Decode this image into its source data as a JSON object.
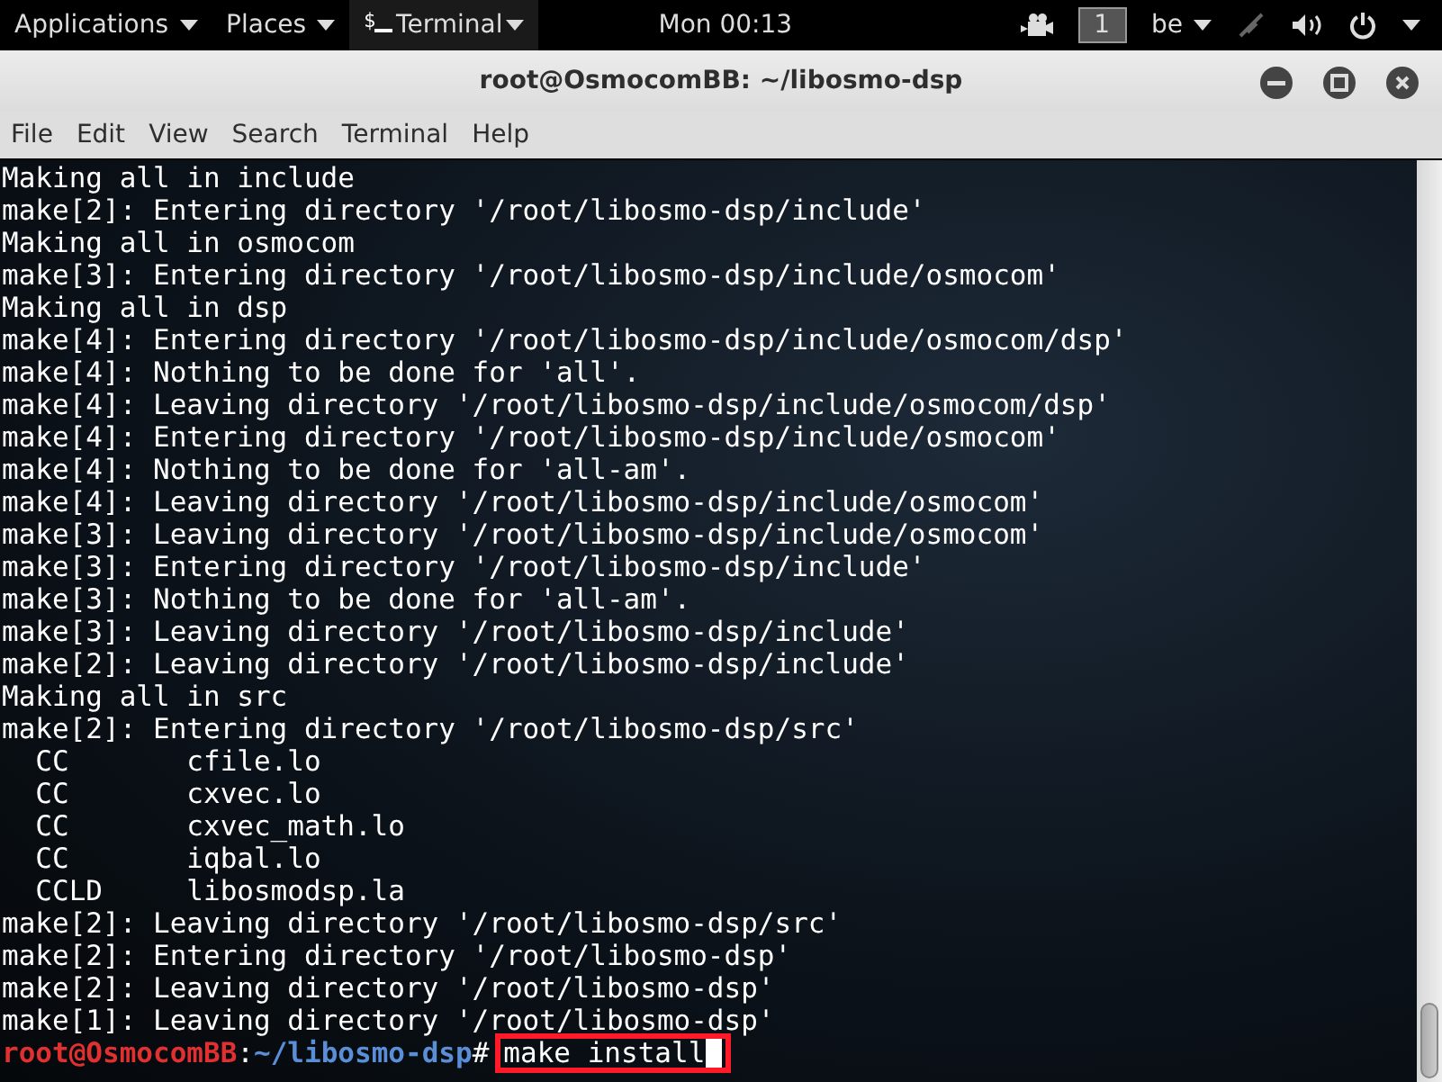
{
  "top_bar": {
    "applications": "Applications",
    "places": "Places",
    "app_icon_glyph": "$",
    "app_menu": "Terminal",
    "clock": "Mon 00:13",
    "workspace": "1",
    "keyboard_layout": "be"
  },
  "window": {
    "title": "root@OsmocomBB: ~/libosmo-dsp"
  },
  "menu": [
    "File",
    "Edit",
    "View",
    "Search",
    "Terminal",
    "Help"
  ],
  "terminal": {
    "lines": [
      "Making all in include",
      "make[2]: Entering directory '/root/libosmo-dsp/include'",
      "Making all in osmocom",
      "make[3]: Entering directory '/root/libosmo-dsp/include/osmocom'",
      "Making all in dsp",
      "make[4]: Entering directory '/root/libosmo-dsp/include/osmocom/dsp'",
      "make[4]: Nothing to be done for 'all'.",
      "make[4]: Leaving directory '/root/libosmo-dsp/include/osmocom/dsp'",
      "make[4]: Entering directory '/root/libosmo-dsp/include/osmocom'",
      "make[4]: Nothing to be done for 'all-am'.",
      "make[4]: Leaving directory '/root/libosmo-dsp/include/osmocom'",
      "make[3]: Leaving directory '/root/libosmo-dsp/include/osmocom'",
      "make[3]: Entering directory '/root/libosmo-dsp/include'",
      "make[3]: Nothing to be done for 'all-am'.",
      "make[3]: Leaving directory '/root/libosmo-dsp/include'",
      "make[2]: Leaving directory '/root/libosmo-dsp/include'",
      "Making all in src",
      "make[2]: Entering directory '/root/libosmo-dsp/src'",
      "  CC       cfile.lo",
      "  CC       cxvec.lo",
      "  CC       cxvec_math.lo",
      "  CC       iqbal.lo",
      "  CCLD     libosmodsp.la",
      "make[2]: Leaving directory '/root/libosmo-dsp/src'",
      "make[2]: Entering directory '/root/libosmo-dsp'",
      "make[2]: Leaving directory '/root/libosmo-dsp'",
      "make[1]: Leaving directory '/root/libosmo-dsp'"
    ],
    "prompt": {
      "user_host": "root@OsmocomBB",
      "separator": ":",
      "path": "~/libosmo-dsp",
      "symbol": "#",
      "command": "make install"
    }
  }
}
